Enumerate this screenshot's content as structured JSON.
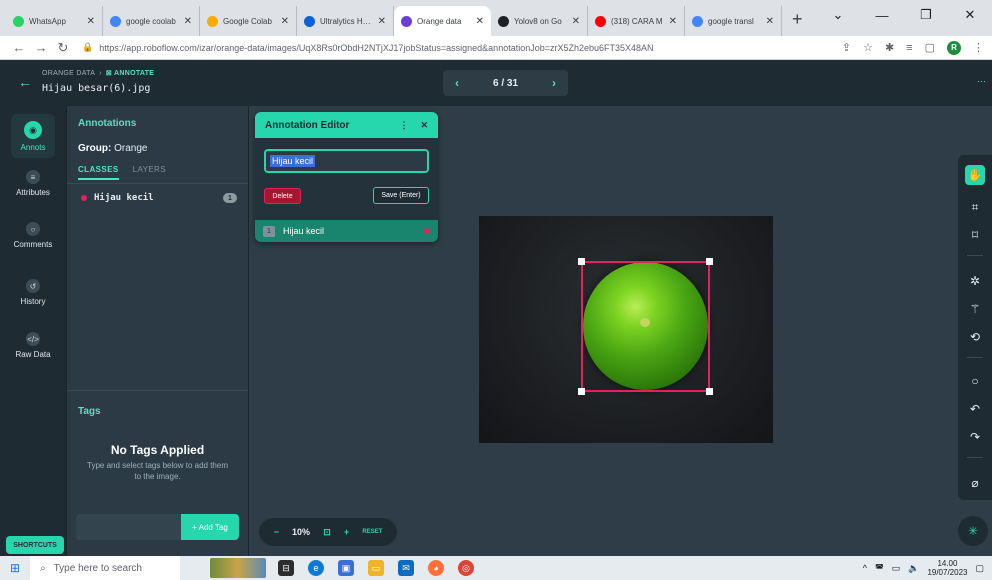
{
  "browser": {
    "tabs": [
      {
        "label": "WhatsApp",
        "color": "#25d366"
      },
      {
        "label": "google coolab",
        "color": "#4285f4"
      },
      {
        "label": "Google Colab",
        "color": "#f9ab00"
      },
      {
        "label": "Ultralytics HUB",
        "color": "#0b62d6"
      },
      {
        "label": "Orange data",
        "color": "#6a3fd1",
        "active": true
      },
      {
        "label": "Yolov8 on Go",
        "color": "#202124"
      },
      {
        "label": "(318) CARA M",
        "color": "#ff0000"
      },
      {
        "label": "google transl",
        "color": "#4285f4"
      }
    ],
    "url": "https://app.roboflow.com/izar/orange-data/images/UqX8Rs0rObdH2NTjXJ17jobStatus=assigned&annotationJob=zrX5Zh2ebu6FT35X48AN",
    "profile_initial": "R"
  },
  "header": {
    "breadcrumb_root": "ORANGE DATA",
    "breadcrumb_current": "ANNOTATE",
    "filename": "Hijau besar(6).jpg",
    "pager": "6 / 31"
  },
  "rail": {
    "items": [
      {
        "label": "Annots"
      },
      {
        "label": "Attributes"
      },
      {
        "label": "Comments"
      },
      {
        "label": "History"
      },
      {
        "label": "Raw Data"
      }
    ],
    "shortcuts": "SHORTCUTS"
  },
  "panel": {
    "title": "Annotations",
    "group_label": "Group:",
    "group_value": "Orange",
    "tab_classes": "CLASSES",
    "tab_layers": "LAYERS",
    "class_name": "Hijau kecil",
    "class_count": "1",
    "tags_title": "Tags",
    "no_tags": "No Tags Applied",
    "no_tags_desc": "Type and select tags below to add them to the image.",
    "add_tag": "+ Add Tag"
  },
  "editor": {
    "title": "Annotation Editor",
    "value": "Hijau kecil",
    "delete": "Delete",
    "save": "Save (Enter)",
    "row_index": "1",
    "row_label": "Hijau kecil"
  },
  "zoom": {
    "minus": "−",
    "level": "10%",
    "plus": "+",
    "reset": "RESET"
  },
  "taskbar": {
    "search_placeholder": "Type here to search",
    "time": "14.00",
    "date": "19/07/2023"
  },
  "colors": {
    "accent": "#26d7ae",
    "annotation": "#e0235d"
  }
}
